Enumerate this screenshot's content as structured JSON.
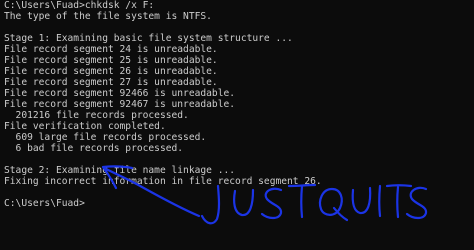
{
  "console": {
    "lines": [
      "C:\\Users\\Fuad>chkdsk /x F:",
      "The type of the file system is NTFS.",
      "",
      "Stage 1: Examining basic file system structure ...",
      "File record segment 24 is unreadable.",
      "File record segment 25 is unreadable.",
      "File record segment 26 is unreadable.",
      "File record segment 27 is unreadable.",
      "File record segment 92466 is unreadable.",
      "File record segment 92467 is unreadable.",
      "  201216 file records processed.",
      "File verification completed.",
      "  609 large file records processed.",
      "  6 bad file records processed.",
      "",
      "Stage 2: Examining file name linkage ...",
      "Fixing incorrect information in file record segment 26.",
      "",
      "C:\\Users\\Fuad>"
    ]
  },
  "annotation": {
    "text": "JUST QUITS",
    "color": "#1b34e6"
  }
}
